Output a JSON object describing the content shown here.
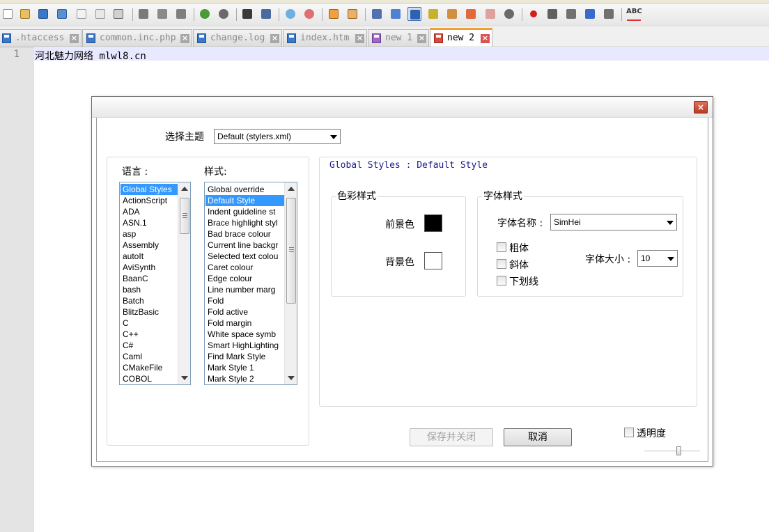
{
  "tabs": [
    {
      "label": ".htaccess",
      "icon": "floppy-icon-blue",
      "active": false
    },
    {
      "label": "common.inc.php",
      "icon": "floppy-icon-blue",
      "active": false
    },
    {
      "label": "change.log",
      "icon": "floppy-icon-blue",
      "active": false
    },
    {
      "label": "index.htm",
      "icon": "floppy-icon-blue",
      "active": false
    },
    {
      "label": "new 1",
      "icon": "floppy-icon-purple",
      "active": false
    },
    {
      "label": "new 2",
      "icon": "floppy-icon-red",
      "active": true
    }
  ],
  "tab_close_glyph": "×",
  "editor": {
    "line_number": "1",
    "line_text": "河北魅力网络 mlwl8.cn"
  },
  "dialog": {
    "close_glyph": "×",
    "theme_label": "选择主题",
    "theme_value": "Default (stylers.xml)",
    "language_label": "语言 :",
    "style_label": "样式:",
    "languages": [
      "Global Styles",
      "ActionScript",
      "ADA",
      "ASN.1",
      "asp",
      "Assembly",
      "autoIt",
      "AviSynth",
      "BaanC",
      "bash",
      "Batch",
      "BlitzBasic",
      "C",
      "C++",
      "C#",
      "Caml",
      "CMakeFile",
      "COBOL"
    ],
    "selected_language": "Global Styles",
    "styles": [
      "Global override",
      "Default Style",
      "Indent guideline st",
      "Brace highlight styl",
      "Bad brace colour",
      "Current line backgr",
      "Selected text colou",
      "Caret colour",
      "Edge colour",
      "Line number marg",
      "Fold",
      "Fold active",
      "Fold margin",
      "White space symb",
      "Smart HighLighting",
      "Find Mark Style",
      "Mark Style 1",
      "Mark Style 2"
    ],
    "selected_style": "Default Style",
    "style_heading": "Global Styles : Default Style",
    "colour_group": "色彩样式",
    "foreground_label": "前景色",
    "background_label": "背景色",
    "foreground_color": "#000000",
    "background_color": "#ffffff",
    "font_group": "字体样式",
    "font_name_label": "字体名称 :",
    "font_name_value": "SimHei",
    "font_size_label": "字体大小 :",
    "font_size_value": "10",
    "bold_label": "粗体",
    "italic_label": "斜体",
    "underline_label": "下划线",
    "save_close_label": "保存并关闭",
    "cancel_label": "取消",
    "transparency_label": "透明度"
  }
}
